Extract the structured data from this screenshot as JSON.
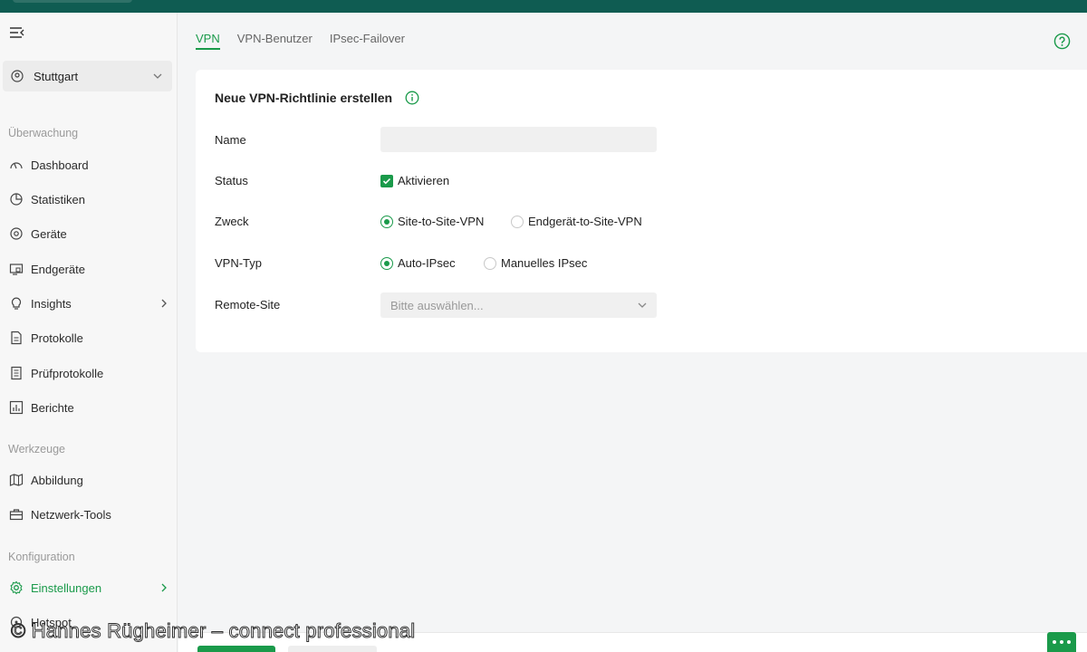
{
  "sidebar": {
    "site": "Stuttgart",
    "sections": {
      "monitoring": "Überwachung",
      "tools": "Werkzeuge",
      "config": "Konfiguration"
    },
    "items": {
      "dashboard": "Dashboard",
      "statistics": "Statistiken",
      "devices": "Geräte",
      "clients": "Endgeräte",
      "insights": "Insights",
      "logs": "Protokolle",
      "audit_logs": "Prüfprotokolle",
      "reports": "Berichte",
      "map": "Abbildung",
      "network_tools": "Netzwerk-Tools",
      "settings": "Einstellungen",
      "hotspot": "Hotspot"
    }
  },
  "tabs": [
    {
      "label": "VPN",
      "active": true
    },
    {
      "label": "VPN-Benutzer",
      "active": false
    },
    {
      "label": "IPsec-Failover",
      "active": false
    }
  ],
  "form": {
    "title": "Neue VPN-Richtlinie erstellen",
    "name_label": "Name",
    "name_value": "",
    "status_label": "Status",
    "status_option": "Aktivieren",
    "status_checked": true,
    "purpose_label": "Zweck",
    "purpose_options": [
      "Site-to-Site-VPN",
      "Endgerät-to-Site-VPN"
    ],
    "purpose_selected": "Site-to-Site-VPN",
    "vpn_type_label": "VPN-Typ",
    "vpn_type_options": [
      "Auto-IPsec",
      "Manuelles IPsec"
    ],
    "vpn_type_selected": "Auto-IPsec",
    "remote_site_label": "Remote-Site",
    "remote_site_placeholder": "Bitte auswählen..."
  },
  "watermark": "© Hannes Rügheimer – connect professional",
  "colors": {
    "accent": "#1a9a4a",
    "topbar": "#0f5c52"
  }
}
